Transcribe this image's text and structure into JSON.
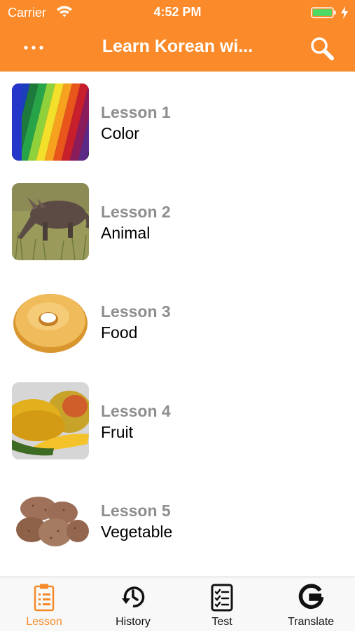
{
  "status_bar": {
    "carrier": "Carrier",
    "time": "4:52 PM",
    "battery_color": "#4cd964"
  },
  "nav_bar": {
    "title": "Learn Korean wi...",
    "left_icon": "more-dots-icon",
    "right_icon": "search-icon",
    "background_color": "#fb8b2a"
  },
  "lessons": [
    {
      "number": "Lesson 1",
      "topic": "Color",
      "thumbnail": "colored-pencils-image"
    },
    {
      "number": "Lesson 2",
      "topic": "Animal",
      "thumbnail": "aardvark-image"
    },
    {
      "number": "Lesson 3",
      "topic": "Food",
      "thumbnail": "donut-image"
    },
    {
      "number": "Lesson 4",
      "topic": "Fruit",
      "thumbnail": "mango-image"
    },
    {
      "number": "Lesson 5",
      "topic": "Vegetable",
      "thumbnail": "potato-image"
    }
  ],
  "tab_bar": {
    "active_color": "#f48a2a",
    "tabs": [
      {
        "label": "Lesson",
        "icon": "clipboard-icon",
        "active": true
      },
      {
        "label": "History",
        "icon": "history-icon",
        "active": false
      },
      {
        "label": "Test",
        "icon": "checklist-icon",
        "active": false
      },
      {
        "label": "Translate",
        "icon": "google-g-icon",
        "active": false
      }
    ]
  }
}
